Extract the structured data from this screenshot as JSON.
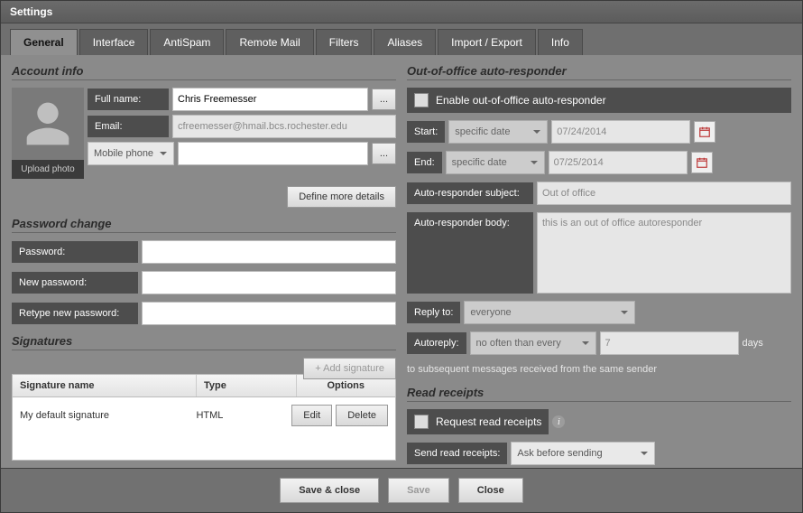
{
  "window": {
    "title": "Settings"
  },
  "tabs": [
    "General",
    "Interface",
    "AntiSpam",
    "Remote Mail",
    "Filters",
    "Aliases",
    "Import / Export",
    "Info"
  ],
  "activeTab": 0,
  "account": {
    "section": "Account info",
    "upload": "Upload photo",
    "fullname_label": "Full name:",
    "fullname": "Chris Freemesser",
    "email_label": "Email:",
    "email": "cfreemesser@hmail.bcs.rochester.edu",
    "contact_type": "Mobile phone",
    "contact_value": "",
    "more": "Define more details"
  },
  "password": {
    "section": "Password change",
    "pw_label": "Password:",
    "new_label": "New password:",
    "retype_label": "Retype new password:"
  },
  "signatures": {
    "section": "Signatures",
    "add": "+ Add signature",
    "cols": {
      "name": "Signature name",
      "type": "Type",
      "options": "Options"
    },
    "rows": [
      {
        "name": "My default signature",
        "type": "HTML"
      }
    ],
    "edit": "Edit",
    "delete": "Delete"
  },
  "ooo": {
    "section": "Out-of-office auto-responder",
    "enable": "Enable out-of-office auto-responder",
    "start_label": "Start:",
    "end_label": "End:",
    "mode": "specific date",
    "start": "07/24/2014",
    "end": "07/25/2014",
    "subject_label": "Auto-responder subject:",
    "subject": "Out of office",
    "body_label": "Auto-responder body:",
    "body": "this is an out of office autoresponder",
    "reply_label": "Reply to:",
    "reply_value": "everyone",
    "autoreply_label": "Autoreply:",
    "autoreply_mode": "no often than every",
    "autoreply_days": "7",
    "autoreply_unit": "days",
    "note": "to subsequent messages received from the same sender"
  },
  "receipts": {
    "section": "Read receipts",
    "request": "Request read receipts",
    "send_label": "Send read receipts:",
    "send_value": "Ask before sending"
  },
  "footer": {
    "save_close": "Save & close",
    "save": "Save",
    "close": "Close"
  }
}
